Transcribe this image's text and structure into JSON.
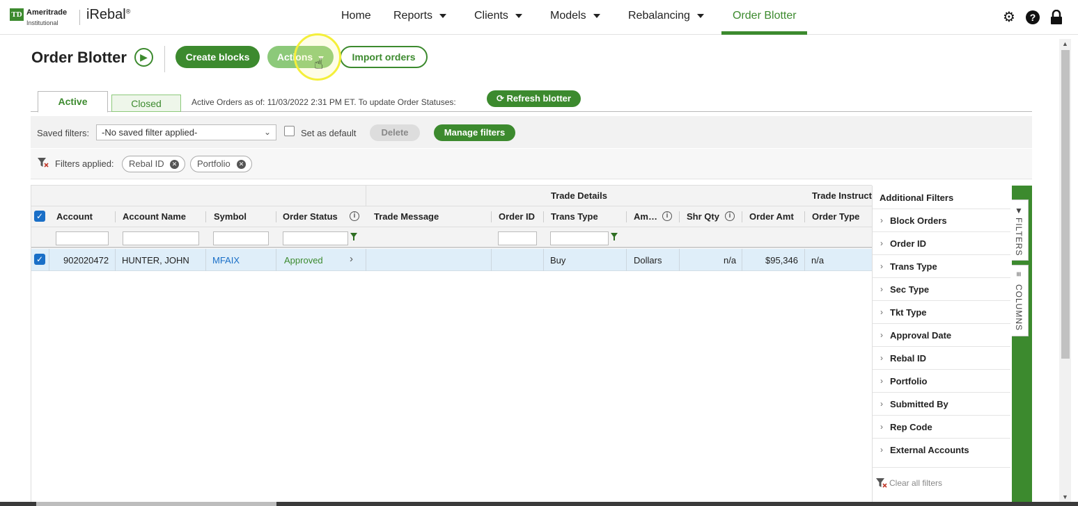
{
  "brand": {
    "logo_mark": "TD",
    "company": "Ameritrade",
    "company_sub": "Institutional",
    "product": "iRebal",
    "product_mark": "®"
  },
  "nav": {
    "items": [
      {
        "label": "Home",
        "has_caret": false
      },
      {
        "label": "Reports",
        "has_caret": true
      },
      {
        "label": "Clients",
        "has_caret": true
      },
      {
        "label": "Models",
        "has_caret": true
      },
      {
        "label": "Rebalancing",
        "has_caret": true
      },
      {
        "label": "Order Blotter",
        "has_caret": false,
        "active": true
      }
    ],
    "icons": [
      "gear-icon",
      "help-icon",
      "lock-icon"
    ]
  },
  "header": {
    "title": "Order Blotter",
    "create_blocks": "Create blocks",
    "actions": "Actions",
    "import_orders": "Import orders"
  },
  "tabs": {
    "active": "Active",
    "closed": "Closed",
    "as_of": "Active Orders as of: 11/03/2022 2:31 PM ET. To update Order Statuses:",
    "refresh": "Refresh blotter"
  },
  "saved_filters": {
    "label": "Saved filters:",
    "selected": "-No saved filter applied-",
    "set_default": "Set as default",
    "delete": "Delete",
    "manage": "Manage filters"
  },
  "applied": {
    "label": "Filters applied:",
    "chips": [
      "Rebal ID",
      "Portfolio"
    ]
  },
  "grid": {
    "groups": [
      "Trade Details",
      "Trade Instruct"
    ],
    "columns": [
      "Account",
      "Account Name",
      "Symbol",
      "Order Status",
      "Trade Message",
      "Order ID",
      "Trans Type",
      "Am…",
      "Shr Qty",
      "Order Amt",
      "Order Type"
    ],
    "rows": [
      {
        "account": "902020472",
        "account_name": "HUNTER, JOHN",
        "symbol": "MFAIX",
        "order_status": "Approved",
        "trade_message": "",
        "order_id": "",
        "trans_type": "Buy",
        "amount_type": "Dollars",
        "shr_qty": "n/a",
        "order_amt": "$95,346",
        "order_type": "n/a"
      }
    ]
  },
  "side_panel": {
    "title": "Additional Filters",
    "items": [
      "Block Orders",
      "Order ID",
      "Trans Type",
      "Sec Type",
      "Tkt Type",
      "Approval Date",
      "Rebal ID",
      "Portfolio",
      "Submitted By",
      "Rep Code",
      "External Accounts"
    ],
    "clear": "Clear all filters",
    "tabs": [
      "FILTERS",
      "COLUMNS"
    ]
  },
  "colors": {
    "brand_green": "#3c8a2e",
    "light_green": "#8cc97a",
    "row_selected": "#dfeef9",
    "link_blue": "#1a6fc7"
  }
}
